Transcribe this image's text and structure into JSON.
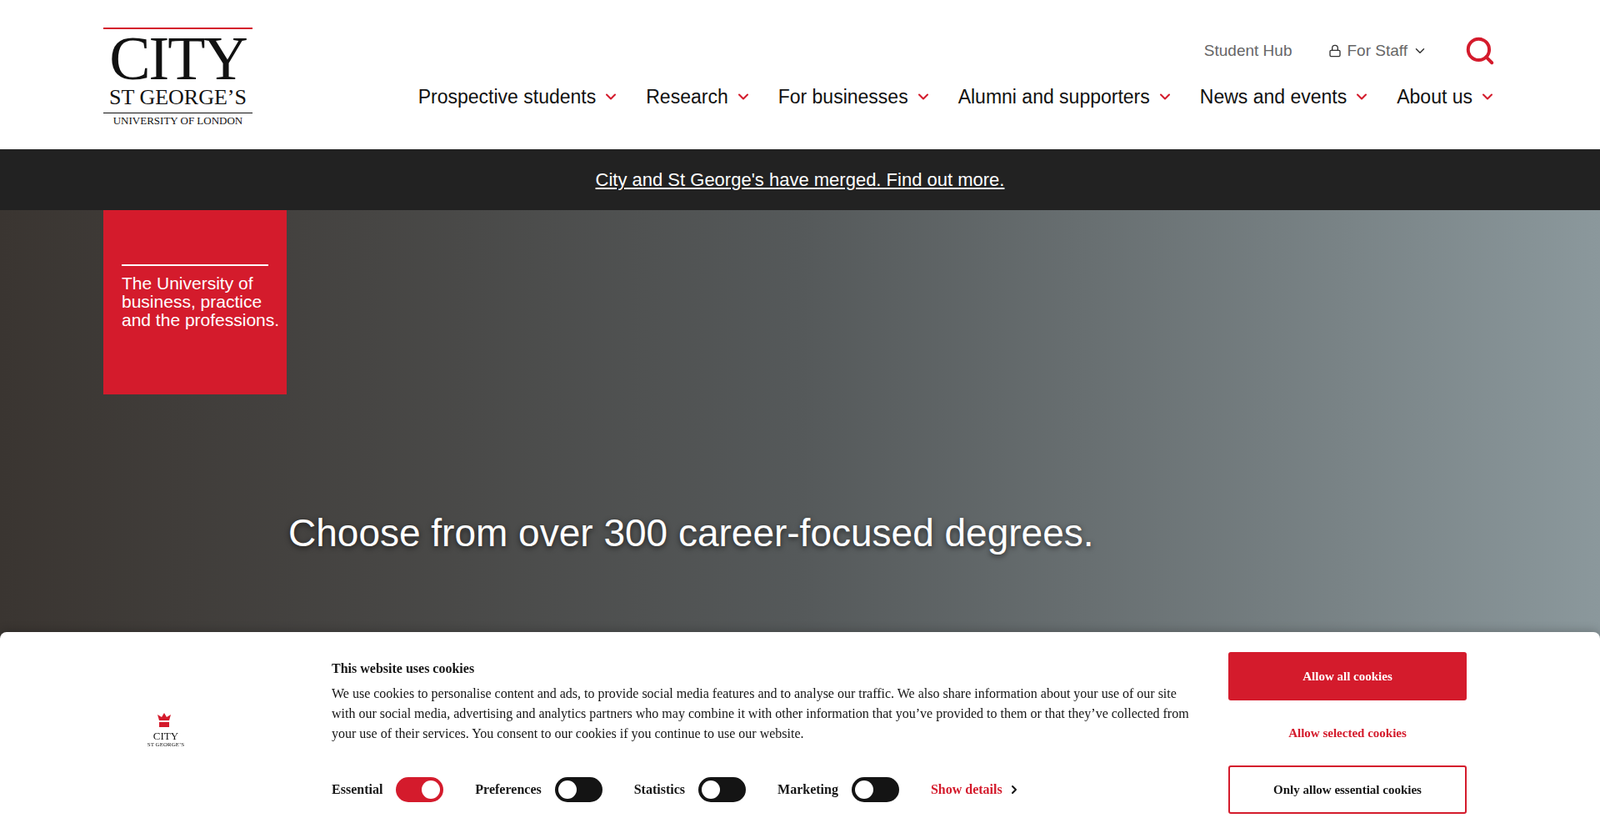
{
  "logo": {
    "title": "CITY",
    "subtitle": "ST GEORGE’S",
    "tagline": "UNIVERSITY OF LONDON"
  },
  "utility_links": [
    {
      "label": "Student Hub",
      "kind": "plain"
    },
    {
      "label": "For Staff",
      "kind": "menu"
    }
  ],
  "nav": [
    {
      "label": "Prospective students"
    },
    {
      "label": "Research"
    },
    {
      "label": "For businesses"
    },
    {
      "label": "Alumni and supporters"
    },
    {
      "label": "News and events"
    },
    {
      "label": "About us"
    }
  ],
  "banner": {
    "link": "City and St George's have merged. Find out more."
  },
  "hero": {
    "badge_lines": [
      "The University of",
      "business, practice",
      "and the professions."
    ],
    "headline": "Choose from over 300 career-focused degrees."
  },
  "cookie_banner": {
    "logo": {
      "title": "CITY",
      "subtitle": "ST GEORGE’S"
    },
    "title": "This website uses cookies",
    "text": "We use cookies to personalise content and ads, to provide social media features and to analyse our traffic. We also share information about your use of our site with our social media, advertising and analytics partners who may combine it with other information that you’ve provided to them or that they’ve collected from your use of their services. You consent to our cookies if you continue to use our website.",
    "toggles": [
      {
        "label": "Essential",
        "on": true
      },
      {
        "label": "Preferences",
        "on": false
      },
      {
        "label": "Statistics",
        "on": false
      },
      {
        "label": "Marketing",
        "on": false
      }
    ],
    "show_details": "Show details",
    "buttons": [
      {
        "label": "Allow all cookies",
        "kind": "primary"
      },
      {
        "label": "Allow selected cookies",
        "kind": "link"
      },
      {
        "label": "Only allow essential cookies",
        "kind": "outline"
      }
    ]
  }
}
